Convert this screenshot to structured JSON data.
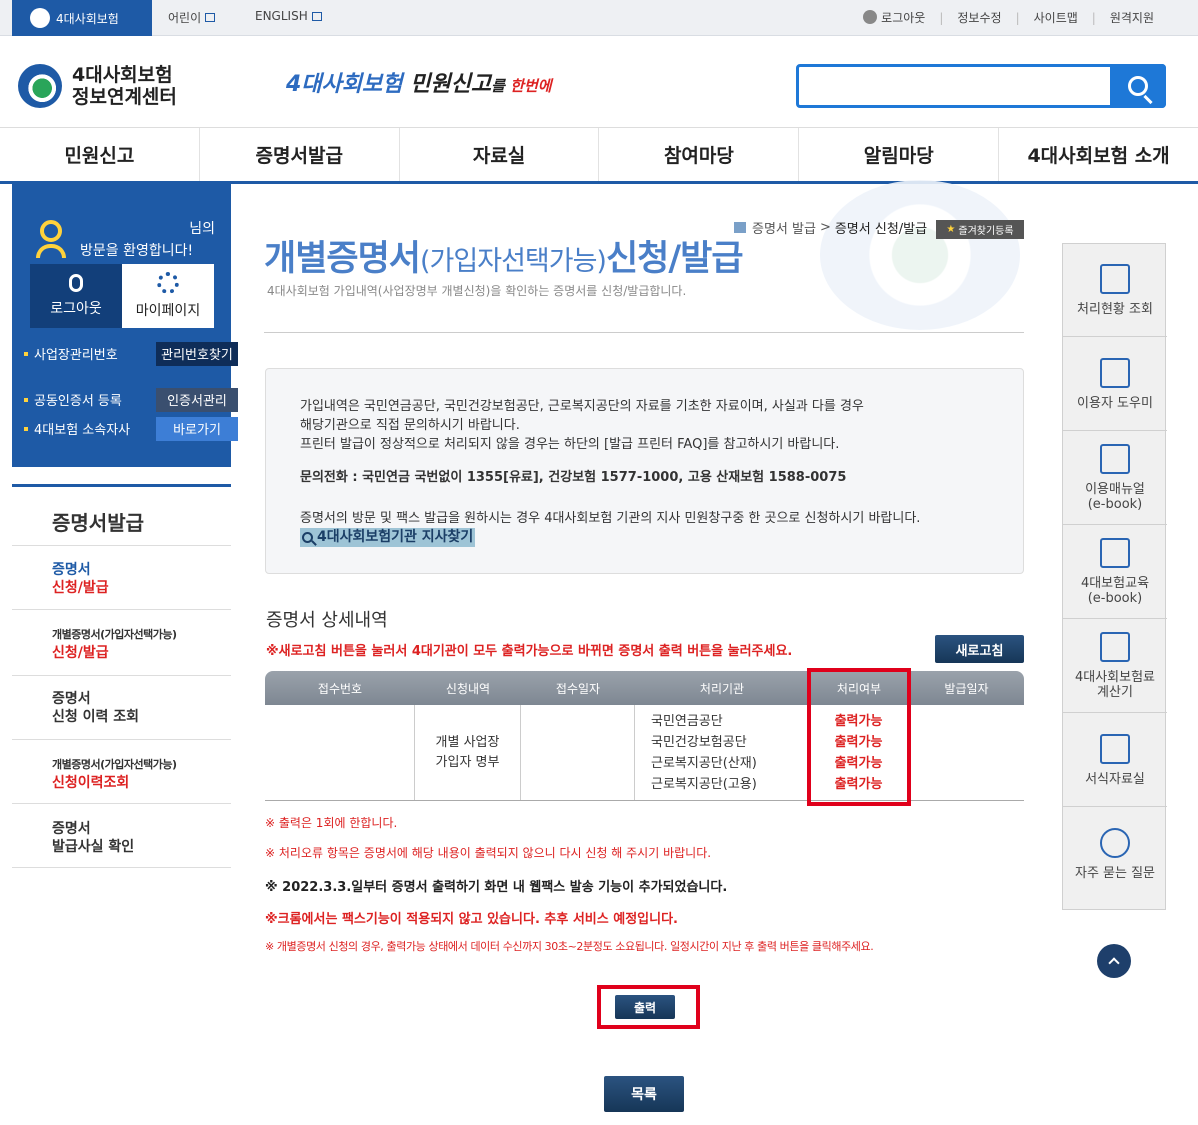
{
  "util": {
    "home_label": "4대사회보험",
    "kids_label": "어린이",
    "english_label": "ENGLISH",
    "logout_label": "로그아웃",
    "edit_info_label": "정보수정",
    "sitemap_label": "사이트맵",
    "remote_label": "원격지원"
  },
  "header": {
    "brand_line1": "4대사회보험",
    "brand_line2": "정보연계센터",
    "slogan_part1": "4대사회보험",
    "slogan_part2": " 민원신고",
    "slogan_part3": "를",
    "slogan_part4": " 한번에"
  },
  "gnb": [
    "민원신고",
    "증명서발급",
    "자료실",
    "참여마당",
    "알림마당",
    "4대사회보험 소개"
  ],
  "login": {
    "nim": "님의",
    "welcome": "방문을 환영합니다!",
    "logout": "로그아웃",
    "mypage": "마이페이지",
    "row1_label": "사업장관리번호",
    "row1_btn": "관리번호찾기",
    "row2_label": "공동인증서 등록",
    "row2_btn": "인증서관리",
    "row3_label": "4대보험 소속자사",
    "row3_btn": "바로가기"
  },
  "lnb": {
    "title": "증명서발급",
    "items": [
      {
        "l1": "증명서",
        "l2": "신청/발급"
      },
      {
        "l1": "개별증명서(가입자선택가능)",
        "l2": "신청/발급"
      },
      {
        "l1": "증명서",
        "l2": "신청 이력 조회"
      },
      {
        "l1": "개별증명서(가입자선택가능)",
        "l2": "신청이력조회"
      },
      {
        "l1": "증명서",
        "l2": "발급사실 확인"
      }
    ]
  },
  "breadcrumb": {
    "parent": "증명서 발급",
    "sep": ">",
    "current": "증명서 신청/발급",
    "fav": "즐겨찾기등록"
  },
  "page": {
    "title_a": "개별증명서",
    "title_b": "(가입자선택가능)",
    "title_c": "신청/발급",
    "subtitle": "4대사회보험 가입내역(사업장명부 개별신청)을 확인하는 증명서를 신청/발급합니다."
  },
  "info": {
    "line1": "가입내역은 국민연금공단, 국민건강보험공단, 근로복지공단의 자료를 기초한 자료이며, 사실과 다를 경우",
    "line2": "해당기관으로 직접 문의하시기 바랍니다.",
    "line3": "프린터 발급이 정상적으로 처리되지 않을 경우는 하단의 [발급 프린터 FAQ]를 참고하시기 바랍니다.",
    "contact": "문의전화 : 국민연금 국번없이 1355[유료], 건강보험 1577-1000, 고용 산재보험 1588-0075",
    "visit": "증명서의 방문 및 팩스 발급을 원하시는 경우 4대사회보험 기관의 지사 민원창구중 한 곳으로 신청하시기 바랍니다.",
    "find_link": "4대사회보험기관 지사찾기"
  },
  "detail": {
    "title": "증명서 상세내역",
    "note": "※새로고침 버튼을 눌러서 4대기관이 모두 출력가능으로 바뀌면 증명서 출력 버튼을 눌러주세요.",
    "refresh": "새로고침",
    "headers": [
      "접수번호",
      "신청내역",
      "접수일자",
      "처리기관",
      "처리여부",
      "발급일자"
    ],
    "row": {
      "receipt_no": "",
      "request_l1": "개별 사업장",
      "request_l2": "가입자 명부",
      "date": "",
      "agencies": [
        "국민연금공단",
        "국민건강보험공단",
        "근로복지공단(산재)",
        "근로복지공단(고용)"
      ],
      "statuses": [
        "출력가능",
        "출력가능",
        "출력가능",
        "출력가능"
      ],
      "issue_date": ""
    }
  },
  "notes": {
    "n1": "※ 출력은 1회에 한합니다.",
    "n2": "※ 처리오류 항목은 증명서에 해당 내용이 출력되지 않으니 다시 신청 해 주시기 바랍니다.",
    "n3": "※ 2022.3.3.일부터 증명서 출력하기 화면 내 웹팩스 발송 기능이 추가되었습니다.",
    "n4": "※크롬에서는 팩스기능이 적용되지 않고 있습니다. 추후 서비스 예정입니다.",
    "n5": "※ 개별증명서 신청의 경우, 출력가능 상태에서 데이터 수신까지 30초~2분정도 소요됩니다. 일정시간이 지난 후 출력 버튼을 클릭해주세요."
  },
  "buttons": {
    "print": "출력",
    "list": "목록"
  },
  "quick": [
    {
      "l1": "처리현황 조회",
      "l2": "",
      "icon": "clipboard-search-icon"
    },
    {
      "l1": "이용자 도우미",
      "l2": "",
      "icon": "help-monitor-icon"
    },
    {
      "l1": "이용매뉴얼",
      "l2": "(e-book)",
      "icon": "manual-icon"
    },
    {
      "l1": "4대보험교육",
      "l2": "(e-book)",
      "icon": "book-icon"
    },
    {
      "l1": "4대사회보험료",
      "l2": "계산기",
      "icon": "calculator-icon"
    },
    {
      "l1": "서식자료실",
      "l2": "",
      "icon": "document-icon"
    },
    {
      "l1": "자주 묻는 질문",
      "l2": "",
      "icon": "faq-icon"
    }
  ],
  "colors": {
    "brand_blue": "#1e5aa6",
    "status_red": "#d22",
    "highlight_red": "#e0001b"
  }
}
